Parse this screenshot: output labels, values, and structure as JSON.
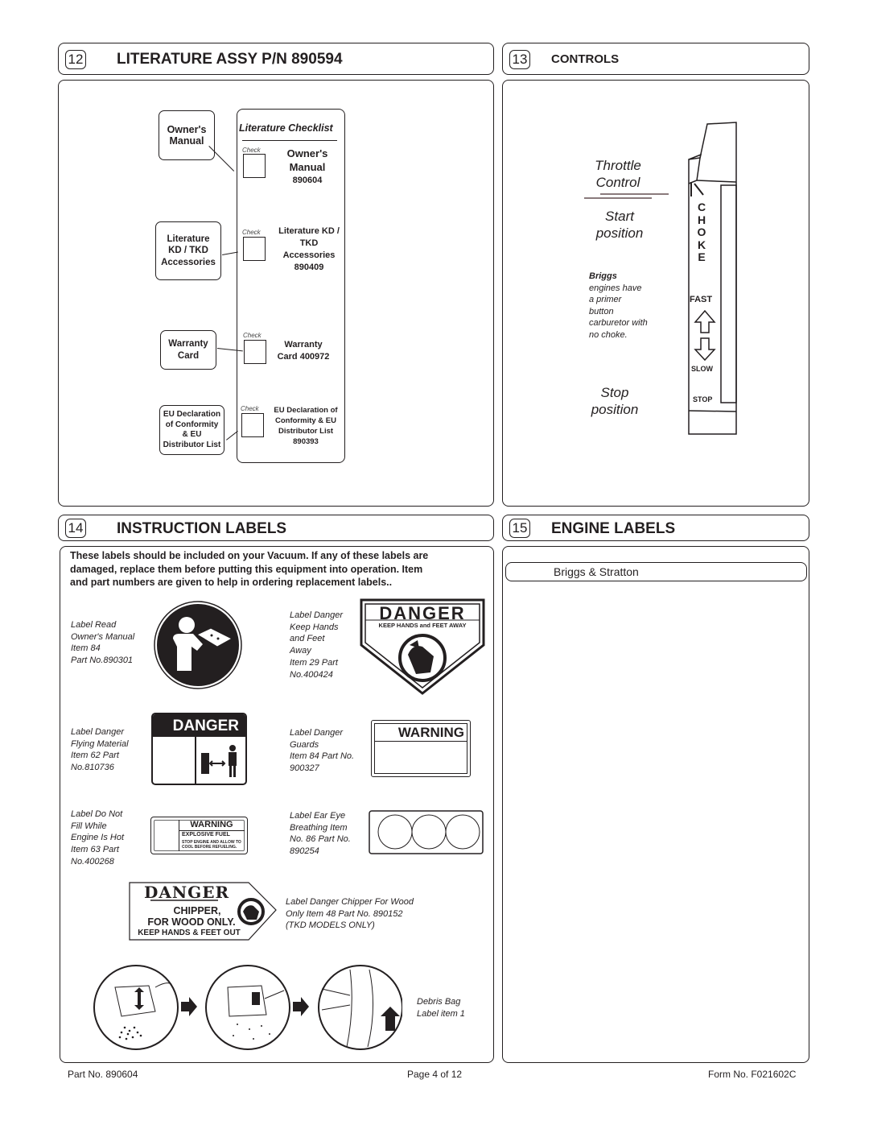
{
  "sections": {
    "literature": {
      "number": "12",
      "title": "LITERATURE ASSY  P/N 890594",
      "checklist_title": "Literature Checklist",
      "check_label": "Check",
      "items": [
        {
          "callout": "Owner's Manual",
          "check_text": "Owner's Manual",
          "part_no": "890604"
        },
        {
          "callout": "Literature KD / TKD Accessories",
          "check_text": "Literature KD / TKD Accessories",
          "part_no": "890409"
        },
        {
          "callout": "Warranty Card",
          "check_text": "Warranty Card  400972",
          "part_no": ""
        },
        {
          "callout": "EU Declaration of Conformity & EU Distributor List",
          "check_text": "EU Declaration of Conformity & EU Distributor List",
          "part_no": "890393"
        }
      ]
    },
    "controls": {
      "number": "13",
      "title": "CONTROLS",
      "throttle_line1": "Throttle",
      "throttle_line2": "Control",
      "start_line1": "Start",
      "start_line2": "position",
      "briggs_bold": "Briggs",
      "briggs_note": [
        "engines have",
        "a primer",
        "button",
        "carburetor with",
        "no choke."
      ],
      "stop_line1": "Stop",
      "stop_line2": "position",
      "lever": {
        "choke_letters": [
          "C",
          "H",
          "O",
          "K",
          "E"
        ],
        "fast": "FAST",
        "slow": "SLOW",
        "stop": "STOP"
      }
    },
    "instruction": {
      "number": "14",
      "title": "INSTRUCTION LABELS",
      "intro": [
        "These labels should be included on your Vacuum.  If any of these labels are",
        "damaged, replace them before putting this equipment into operation. Item",
        "and part numbers are given to help in ordering replacement labels.."
      ],
      "labels": [
        {
          "desc": [
            "Label Read",
            "Owner's Manual",
            "Item 84",
            "Part No.890301"
          ],
          "icon": "read-manual-icon"
        },
        {
          "desc": [
            "Label Danger",
            "Keep Hands",
            "and Feet",
            "Away",
            "Item 29  Part",
            "No.400424"
          ],
          "sign_title": "DANGER",
          "sign_sub": "KEEP HANDS and FEET AWAY",
          "icon": "hand-warning-icon"
        },
        {
          "desc": [
            "Label Danger",
            "Flying Material",
            "Item 62  Part",
            "No.810736"
          ],
          "sign_title": "DANGER",
          "icon": "keep-distance-icon"
        },
        {
          "desc": [
            "Label Danger",
            "Guards",
            "Item 84 Part No.",
            "900327"
          ],
          "sign_title": "WARNING"
        },
        {
          "desc": [
            "Label Do Not",
            "Fill While",
            "Engine Is Hot",
            "Item 63  Part",
            "No.400268"
          ],
          "sign_title": "WARNING",
          "sign_sub": "EXPLOSIVE FUEL",
          "sign_body": [
            "STOP ENGINE AND ALLOW TO",
            "COOL BEFORE REFUELING."
          ]
        },
        {
          "desc": [
            "Label Ear Eye",
            "Breathing Item",
            "No. 86 Part No.",
            "890254"
          ],
          "icon": "ppe-circles-icon"
        },
        {
          "desc": [
            "Label Danger Chipper For Wood",
            "Only  Item 48 Part No. 890152",
            "(TKD MODELS ONLY)"
          ],
          "sign_title": "DANGER",
          "sign_lines": [
            "CHIPPER,",
            "FOR WOOD ONLY.",
            "KEEP HANDS & FEET OUT"
          ]
        },
        {
          "desc": [
            "Debris Bag",
            "Label item 1"
          ],
          "icon": "debris-bag-steps-icon"
        }
      ]
    },
    "engine": {
      "number": "15",
      "title": "ENGINE LABELS",
      "brand": "Briggs & Stratton"
    }
  },
  "footer": {
    "part_no": "Part No. 890604",
    "page": "Page 4 of 12",
    "form_no": "Form No. F021602C"
  }
}
